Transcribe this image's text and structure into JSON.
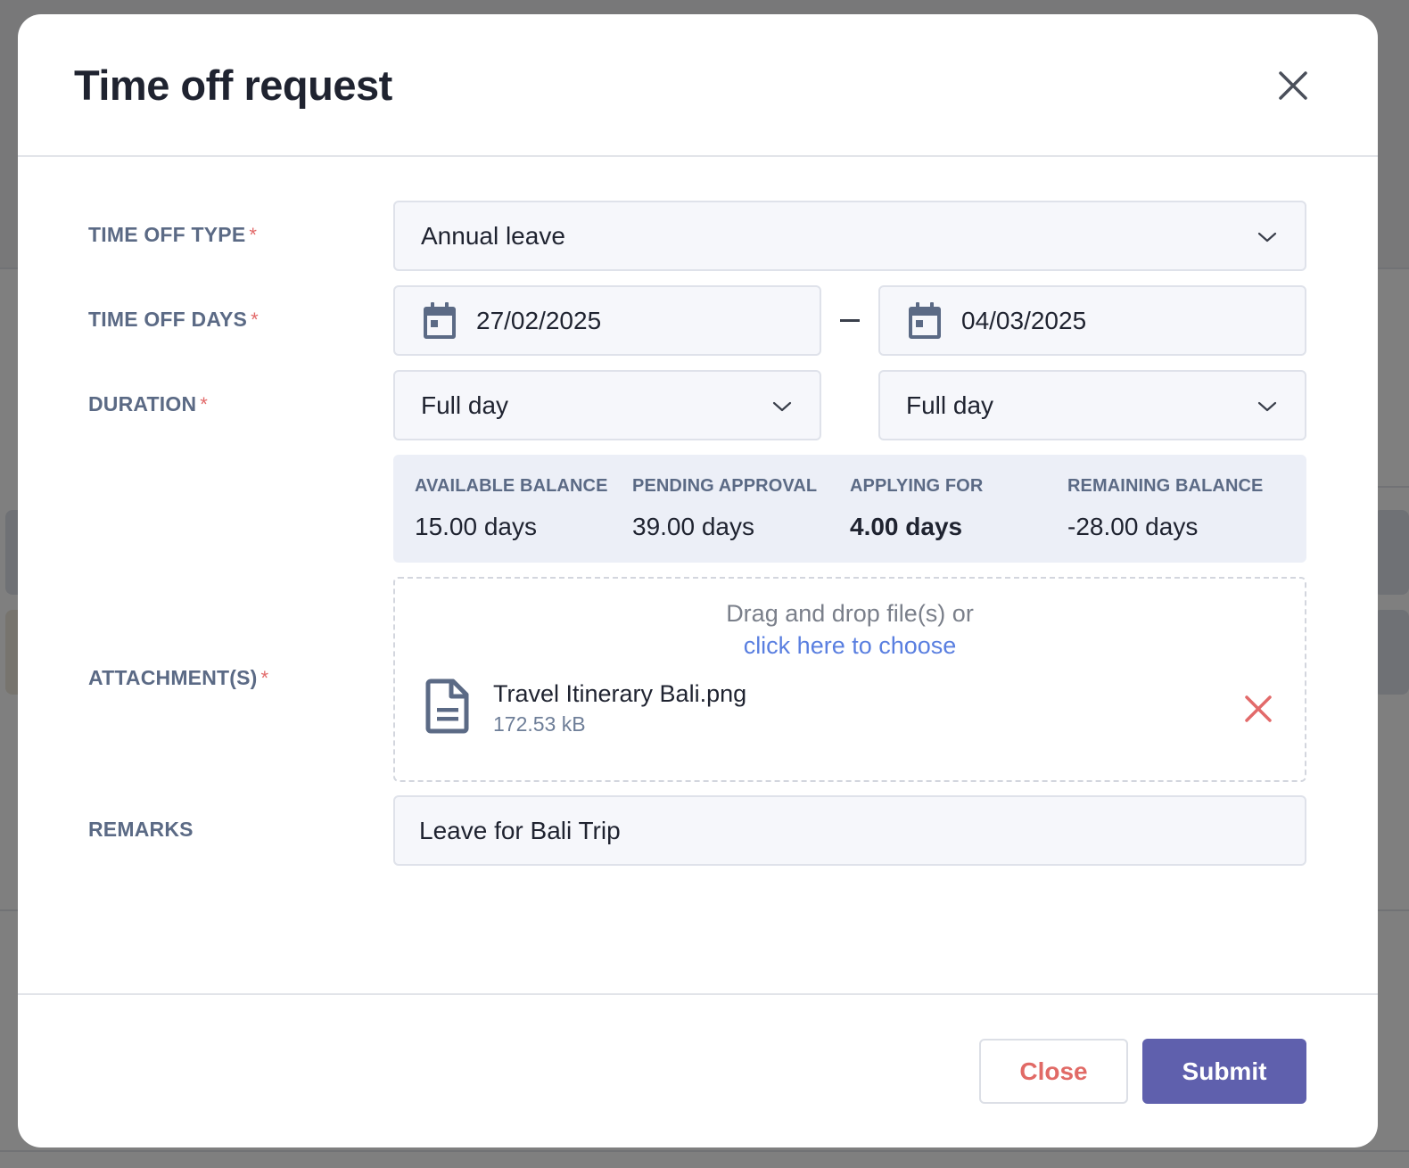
{
  "modal": {
    "title": "Time off request"
  },
  "form": {
    "time_off_type": {
      "label": "TIME OFF TYPE",
      "required_mark": "*",
      "value": "Annual leave"
    },
    "time_off_days": {
      "label": "TIME OFF DAYS",
      "required_mark": "*",
      "start_date": "27/02/2025",
      "end_date": "04/03/2025"
    },
    "duration": {
      "label": "DURATION",
      "required_mark": "*",
      "start_value": "Full day",
      "end_value": "Full day"
    },
    "balance": {
      "available": {
        "label": "AVAILABLE BALANCE",
        "value": "15.00 days"
      },
      "pending": {
        "label": "PENDING APPROVAL",
        "value": "39.00 days"
      },
      "applying": {
        "label": "APPLYING FOR",
        "value": "4.00 days"
      },
      "remaining": {
        "label": "REMAINING BALANCE",
        "value": "-28.00 days"
      }
    },
    "attachments": {
      "label": "ATTACHMENT(S)",
      "required_mark": "*",
      "drop_text": "Drag and drop file(s) or",
      "choose_link": "click here to choose",
      "files": [
        {
          "name": "Travel Itinerary Bali.png",
          "size": "172.53 kB"
        }
      ]
    },
    "remarks": {
      "label": "REMARKS",
      "value": "Leave for Bali Trip"
    }
  },
  "footer": {
    "close_label": "Close",
    "submit_label": "Submit"
  },
  "colors": {
    "accent": "#5f60ad",
    "danger": "#e16a66",
    "link": "#5a7fe0",
    "label": "#5b6a85"
  }
}
